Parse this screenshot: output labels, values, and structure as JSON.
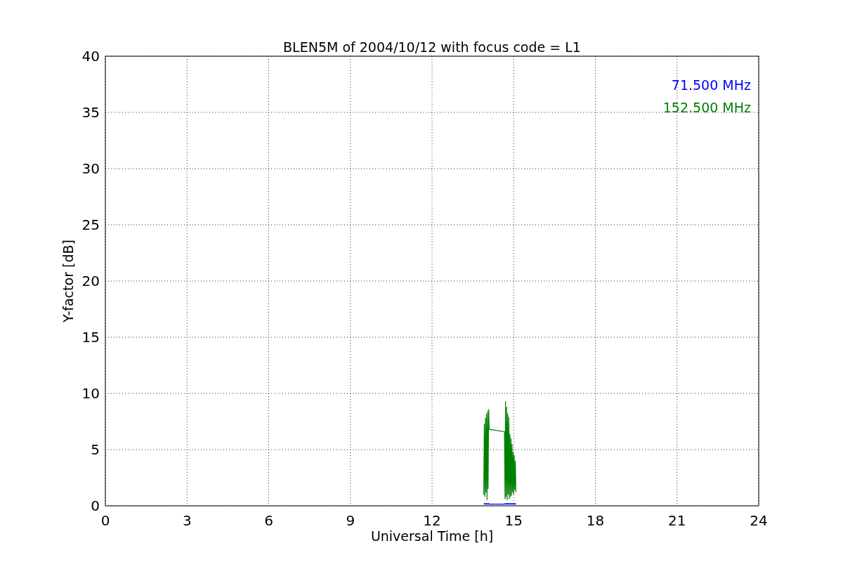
{
  "chart_data": {
    "type": "line",
    "title": "BLEN5M of 2004/10/12 with focus code = L1",
    "xlabel": "Universal Time [h]",
    "ylabel": "Y-factor [dB]",
    "x": [
      13.9,
      13.92,
      13.94,
      13.96,
      13.98,
      14.0,
      14.02,
      14.04,
      14.06,
      14.08,
      14.1,
      14.66,
      14.68,
      14.7,
      14.72,
      14.74,
      14.76,
      14.78,
      14.8,
      14.82,
      14.84,
      14.86,
      14.88,
      14.9,
      14.92,
      14.94,
      14.96,
      14.98,
      15.0,
      15.02,
      15.04,
      15.06,
      15.08
    ],
    "series": [
      {
        "name": "71.500 MHz",
        "color": "#0000ff",
        "values": [
          0.15,
          0.2,
          0.15,
          0.2,
          0.15,
          0.2,
          0.15,
          0.2,
          0.15,
          0.2,
          0.15,
          0.15,
          0.2,
          0.15,
          0.2,
          0.15,
          0.2,
          0.15,
          0.2,
          0.15,
          0.2,
          0.15,
          0.2,
          0.15,
          0.2,
          0.15,
          0.2,
          0.15,
          0.2,
          0.15,
          0.2,
          0.15,
          0.2
        ]
      },
      {
        "name": "152.500 MHz",
        "color": "#008000",
        "values": [
          1,
          7.3,
          0.8,
          7.8,
          1.2,
          8.2,
          0.5,
          8.4,
          1.5,
          8.6,
          6.8,
          6.6,
          0.6,
          9.3,
          0.8,
          8.8,
          0.5,
          8.2,
          1,
          7.9,
          0.6,
          6.4,
          0.8,
          6,
          0.9,
          5.5,
          1.2,
          4.8,
          1,
          4.5,
          1.4,
          4,
          1.2
        ]
      }
    ],
    "grid": true,
    "xlim": [
      0,
      24
    ],
    "ylim": [
      0,
      40
    ],
    "xticks": [
      0,
      3,
      6,
      9,
      12,
      15,
      18,
      21,
      24
    ],
    "yticks": [
      0,
      5,
      10,
      15,
      20,
      25,
      30,
      35,
      40
    ]
  }
}
